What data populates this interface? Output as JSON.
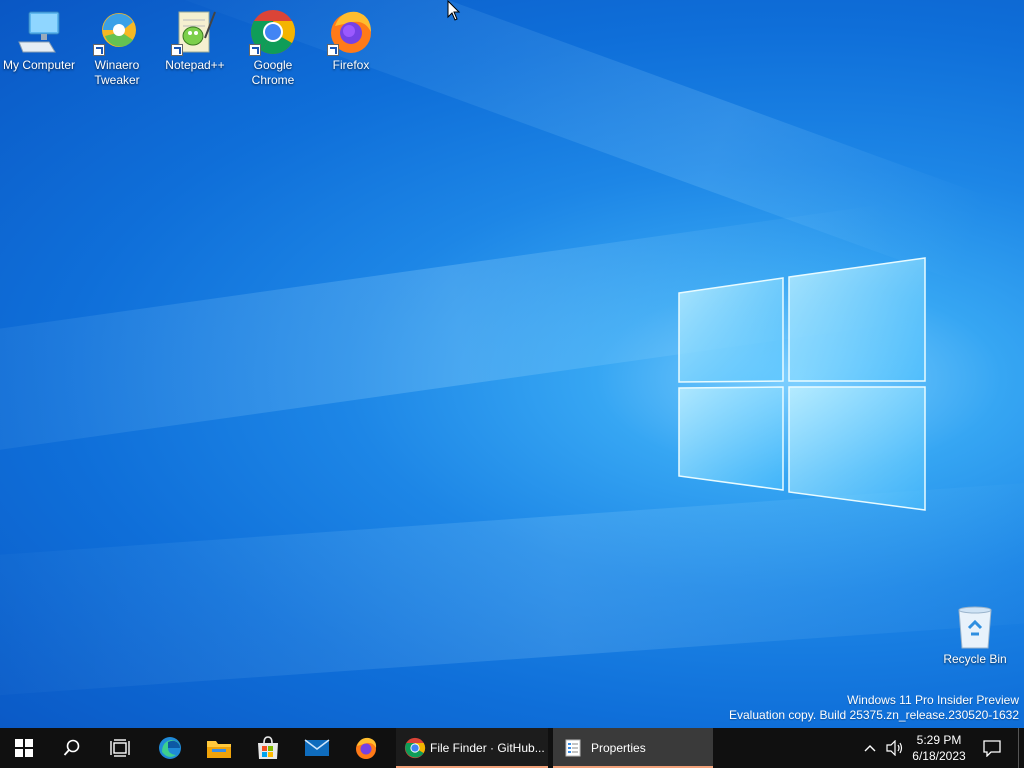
{
  "desktop": {
    "icons": [
      {
        "label": "My Computer",
        "icon": "computer-icon"
      },
      {
        "label": "Winaero Tweaker",
        "icon": "winaero-tweaker-icon"
      },
      {
        "label": "Notepad++",
        "icon": "notepadpp-icon"
      },
      {
        "label": "Google Chrome",
        "icon": "chrome-icon"
      },
      {
        "label": "Firefox",
        "icon": "firefox-icon"
      },
      {
        "label": "Recycle Bin",
        "icon": "recycle-bin-icon"
      }
    ],
    "watermark": {
      "line1": "Windows 11 Pro Insider Preview",
      "line2": "Evaluation copy. Build 25375.zn_release.230520-1632"
    }
  },
  "taskbar": {
    "start_icon": "windows-start-icon",
    "pinned": [
      "search-icon",
      "task-view-icon",
      "edge-icon",
      "file-explorer-icon",
      "microsoft-store-icon",
      "mail-icon",
      "firefox-icon"
    ],
    "apps": [
      {
        "label": "File Finder · GitHub...",
        "icon": "chrome-icon",
        "state": "running"
      },
      {
        "label": "Properties",
        "icon": "properties-icon",
        "state": "active"
      }
    ],
    "tray": {
      "time": "5:29 PM",
      "date": "6/18/2023"
    },
    "colors": {
      "taskbar": "#101010",
      "active_app": "#3a3a3a",
      "underline": "#f2a27a"
    }
  }
}
